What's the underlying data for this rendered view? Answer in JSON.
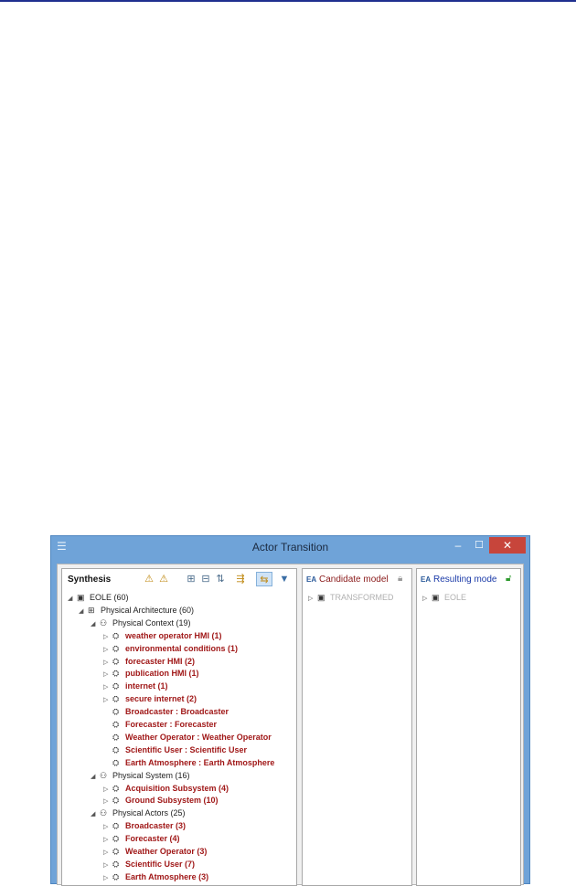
{
  "window": {
    "title": "Actor Transition",
    "min_label": "–",
    "max_label": "☐",
    "close_label": "✕"
  },
  "synthesis": {
    "label": "Synthesis",
    "toolbar": [
      "⚠",
      "⚠",
      "⊞",
      "⊟",
      "⇅",
      "⇶",
      "⇆",
      "▼"
    ]
  },
  "candidate": {
    "label": "Candidate model",
    "tree": [
      {
        "text": "TRANSFORMED"
      }
    ]
  },
  "resulting": {
    "label": "Resulting mode",
    "tree": [
      {
        "text": "EOLE"
      }
    ]
  },
  "tree": [
    {
      "text": "EOLE (60)",
      "lvl": 0,
      "style": "dark",
      "twisty": "◢"
    },
    {
      "text": "Physical Architecture (60)",
      "lvl": 1,
      "style": "dark",
      "twisty": "◢"
    },
    {
      "text": "Physical Context (19)",
      "lvl": 2,
      "style": "dark",
      "twisty": "◢"
    },
    {
      "text": "weather operator HMI (1)",
      "lvl": 3,
      "style": "red",
      "twisty": "▷"
    },
    {
      "text": "environmental conditions (1)",
      "lvl": 3,
      "style": "red",
      "twisty": "▷"
    },
    {
      "text": "forecaster HMI (2)",
      "lvl": 3,
      "style": "red",
      "twisty": "▷"
    },
    {
      "text": "publication HMI (1)",
      "lvl": 3,
      "style": "red",
      "twisty": "▷"
    },
    {
      "text": "internet (1)",
      "lvl": 3,
      "style": "red",
      "twisty": "▷"
    },
    {
      "text": "secure internet (2)",
      "lvl": 3,
      "style": "red",
      "twisty": "▷"
    },
    {
      "text": "Broadcaster : Broadcaster",
      "lvl": 3,
      "style": "red",
      "twisty": ""
    },
    {
      "text": "Forecaster : Forecaster",
      "lvl": 3,
      "style": "red",
      "twisty": ""
    },
    {
      "text": "Weather Operator : Weather Operator",
      "lvl": 3,
      "style": "red",
      "twisty": ""
    },
    {
      "text": "Scientific User : Scientific User",
      "lvl": 3,
      "style": "red",
      "twisty": ""
    },
    {
      "text": "Earth Atmosphere : Earth Atmosphere",
      "lvl": 3,
      "style": "red",
      "twisty": ""
    },
    {
      "text": "Physical System (16)",
      "lvl": 2,
      "style": "dark",
      "twisty": "◢"
    },
    {
      "text": "Acquisition Subsystem (4)",
      "lvl": 3,
      "style": "red",
      "twisty": "▷"
    },
    {
      "text": "Ground Subsystem (10)",
      "lvl": 3,
      "style": "red",
      "twisty": "▷"
    },
    {
      "text": "Physical Actors (25)",
      "lvl": 2,
      "style": "dark",
      "twisty": "◢"
    },
    {
      "text": "Broadcaster (3)",
      "lvl": 3,
      "style": "red",
      "twisty": "▷"
    },
    {
      "text": "Forecaster (4)",
      "lvl": 3,
      "style": "red",
      "twisty": "▷"
    },
    {
      "text": "Weather Operator (3)",
      "lvl": 3,
      "style": "red",
      "twisty": "▷"
    },
    {
      "text": "Scientific User (7)",
      "lvl": 3,
      "style": "red",
      "twisty": "▷"
    },
    {
      "text": "Earth Atmosphere (3)",
      "lvl": 3,
      "style": "red",
      "twisty": "▷"
    }
  ]
}
